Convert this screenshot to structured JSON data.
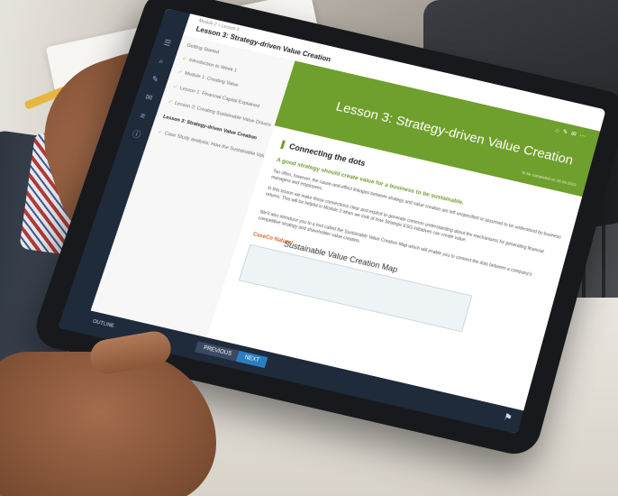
{
  "tablet_app": {
    "breadcrumb": "Module 2 > Lesson 3",
    "lesson_title": "Lesson 3: Strategy-driven Value Creation",
    "toc": {
      "rows": [
        {
          "label": "Getting Started",
          "done": false
        },
        {
          "label": "Introduction to Week 1",
          "done": true
        },
        {
          "label": "Module 1: Creating Value",
          "done": true
        },
        {
          "label": "Lesson 1: Financial Capital Explained",
          "done": true
        },
        {
          "label": "Lesson 2: Creating Sustainable Value Drivers",
          "done": true
        },
        {
          "label": "Lesson 3: Strategy-driven Value Creation",
          "done": false
        },
        {
          "label": "Case Study analysis: How the Sustainable Value Creation Map Led DSM",
          "done": true
        }
      ]
    },
    "banner": {
      "title": "Lesson 3: Strategy-driven Value Creation",
      "date": "To be completed on 25.09.2023",
      "icons": [
        "home-icon",
        "edit-icon",
        "chat-icon",
        "more-icon"
      ]
    },
    "section_heading": "Connecting the dots",
    "kicker": "A good strategy should create value for a business to be sustainable.",
    "paragraphs": [
      "Too often, however, the cause-and-effect linkages between strategy and value creation are left unspecified or assumed to be understood by business managers and employees.",
      "In this lesson we make these connections clear and explicit to generate common understanding about the mechanisms for generating financial returns. This will be helpful in Module 3 when we look at how Strategic ESG initiatives can create value.",
      "We'll also introduce you to a tool called the Sustainable Value Creation Map which will enable you to connect the dots between a company's competitive strategy and shareholder value creation."
    ],
    "map": {
      "logo": "CaseCo Natural",
      "title": "Sustainable Value Creation Map"
    },
    "bottom_bar": {
      "outline_label": "OUTLINE",
      "previous_label": "PREVIOUS",
      "next_label": "NEXT"
    },
    "colors": {
      "accent_green": "#6f9f2c",
      "nav_dark": "#1f2a3a",
      "next_blue": "#2b7fc1"
    }
  }
}
